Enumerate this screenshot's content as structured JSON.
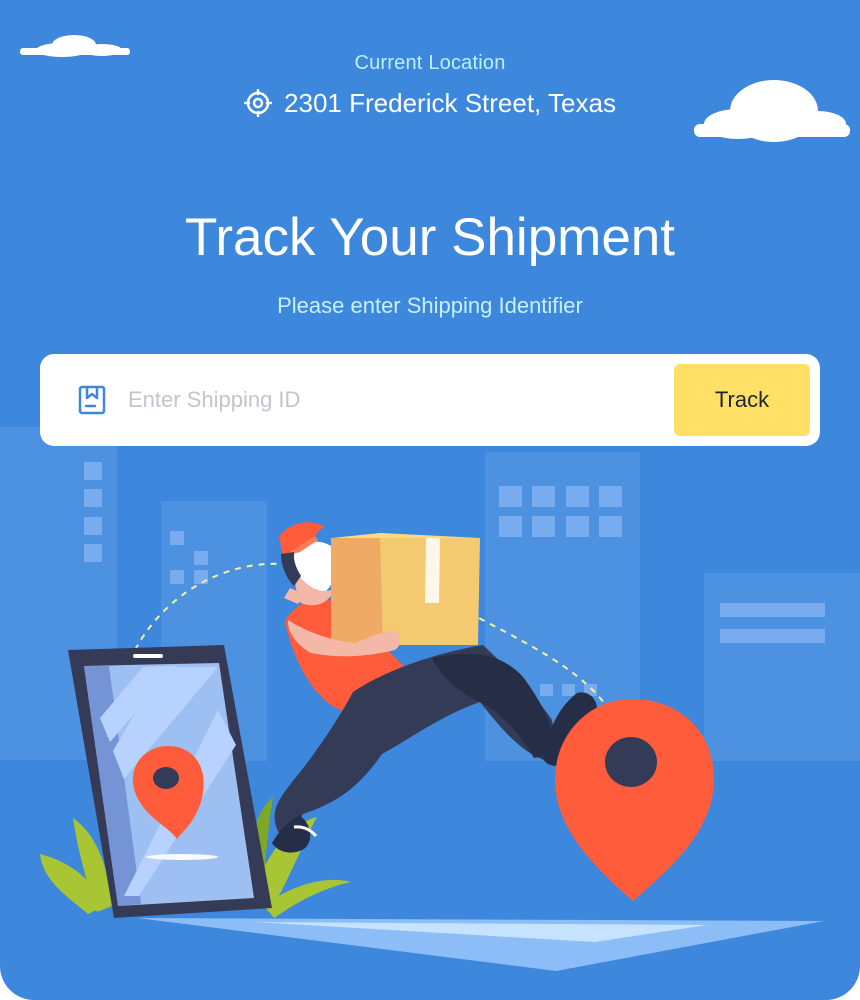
{
  "location": {
    "label": "Current Location",
    "address": "2301 Frederick Street, Texas",
    "icon": "target-icon"
  },
  "hero": {
    "title": "Track Your Shipment",
    "subtitle": "Please enter Shipping Identifier"
  },
  "search": {
    "icon": "package-icon",
    "placeholder": "Enter Shipping ID",
    "value": "",
    "button_label": "Track"
  },
  "colors": {
    "background": "#3d87dc",
    "button": "#ffe066",
    "accent": "#ff5c3b"
  }
}
